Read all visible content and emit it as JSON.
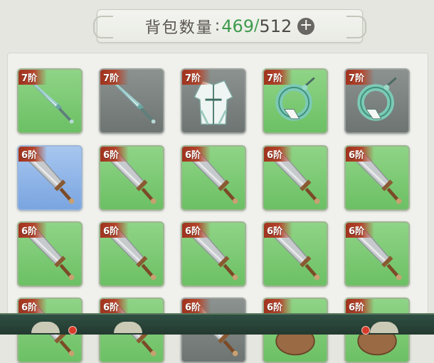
{
  "inventory": {
    "label": "背包数量",
    "separator": ":",
    "current": "469",
    "slash": "/",
    "max": "512",
    "add_symbol": "+"
  },
  "items": [
    {
      "tier": "7阶",
      "item": "jade-dagger-icon",
      "bg": "green"
    },
    {
      "tier": "7阶",
      "item": "jade-dagger-icon",
      "bg": "gray"
    },
    {
      "tier": "7阶",
      "item": "robe-armor-icon",
      "bg": "gray"
    },
    {
      "tier": "7阶",
      "item": "jade-ring-icon",
      "bg": "green"
    },
    {
      "tier": "7阶",
      "item": "jade-ring-icon",
      "bg": "gray"
    },
    {
      "tier": "6阶",
      "item": "broadsword-icon",
      "bg": "blue"
    },
    {
      "tier": "6阶",
      "item": "broadsword-icon",
      "bg": "green"
    },
    {
      "tier": "6阶",
      "item": "broadsword-icon",
      "bg": "green"
    },
    {
      "tier": "6阶",
      "item": "broadsword-icon",
      "bg": "green"
    },
    {
      "tier": "6阶",
      "item": "broadsword-icon",
      "bg": "green"
    },
    {
      "tier": "6阶",
      "item": "broadsword-icon",
      "bg": "green"
    },
    {
      "tier": "6阶",
      "item": "broadsword-icon",
      "bg": "green"
    },
    {
      "tier": "6阶",
      "item": "broadsword-icon",
      "bg": "green"
    },
    {
      "tier": "6阶",
      "item": "broadsword-icon",
      "bg": "green"
    },
    {
      "tier": "6阶",
      "item": "broadsword-icon",
      "bg": "green"
    },
    {
      "tier": "6阶",
      "item": "broadsword-icon",
      "bg": "green"
    },
    {
      "tier": "6阶",
      "item": "broadsword-icon",
      "bg": "green"
    },
    {
      "tier": "6阶",
      "item": "broadsword-icon",
      "bg": "gray"
    },
    {
      "tier": "6阶",
      "item": "bag-icon",
      "bg": "green"
    },
    {
      "tier": "6阶",
      "item": "bag-icon",
      "bg": "green"
    }
  ],
  "colors": {
    "count_green": "#3d9b4e",
    "tier_badge": "#a0331e",
    "slot_green": "#7cc874",
    "slot_gray": "#7a8180",
    "slot_blue": "#8db4e8"
  }
}
